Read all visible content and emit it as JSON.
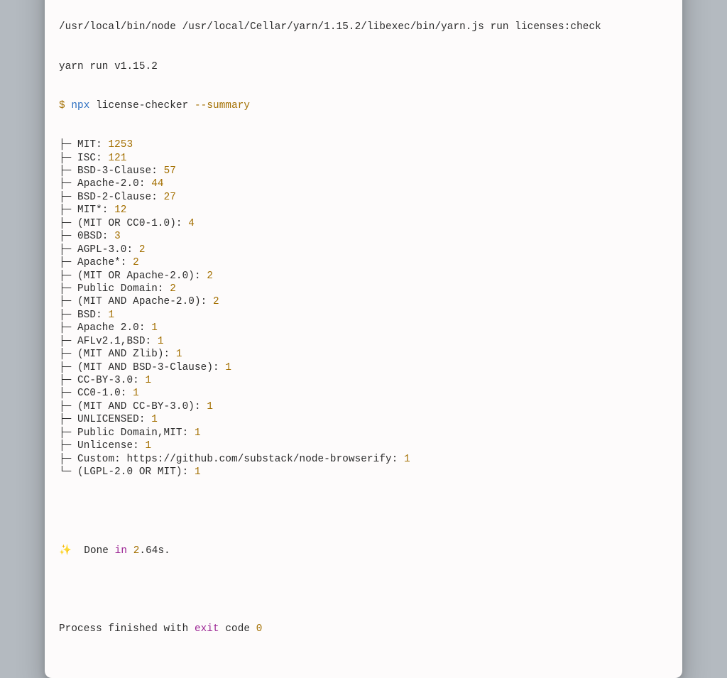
{
  "header": {
    "invocation": "/usr/local/bin/node /usr/local/Cellar/yarn/1.15.2/libexec/bin/yarn.js run licenses:check",
    "yarn_version_line": "yarn run v1.15.2"
  },
  "command": {
    "prompt": "$",
    "bin": "npx",
    "tool": "license-checker",
    "flag": "--summary"
  },
  "licenses": [
    {
      "prefix": "├─ ",
      "name": "MIT",
      "count": 1253
    },
    {
      "prefix": "├─ ",
      "name": "ISC",
      "count": 121
    },
    {
      "prefix": "├─ ",
      "name": "BSD-3-Clause",
      "count": 57
    },
    {
      "prefix": "├─ ",
      "name": "Apache-2.0",
      "count": 44
    },
    {
      "prefix": "├─ ",
      "name": "BSD-2-Clause",
      "count": 27
    },
    {
      "prefix": "├─ ",
      "name": "MIT*",
      "count": 12
    },
    {
      "prefix": "├─ ",
      "name": "(MIT OR CC0-1.0)",
      "count": 4
    },
    {
      "prefix": "├─ ",
      "name": "0BSD",
      "count": 3
    },
    {
      "prefix": "├─ ",
      "name": "AGPL-3.0",
      "count": 2
    },
    {
      "prefix": "├─ ",
      "name": "Apache*",
      "count": 2
    },
    {
      "prefix": "├─ ",
      "name": "(MIT OR Apache-2.0)",
      "count": 2
    },
    {
      "prefix": "├─ ",
      "name": "Public Domain",
      "count": 2
    },
    {
      "prefix": "├─ ",
      "name": "(MIT AND Apache-2.0)",
      "count": 2
    },
    {
      "prefix": "├─ ",
      "name": "BSD",
      "count": 1
    },
    {
      "prefix": "├─ ",
      "name": "Apache 2.0",
      "count": 1
    },
    {
      "prefix": "├─ ",
      "name": "AFLv2.1,BSD",
      "count": 1
    },
    {
      "prefix": "├─ ",
      "name": "(MIT AND Zlib)",
      "count": 1
    },
    {
      "prefix": "├─ ",
      "name": "(MIT AND BSD-3-Clause)",
      "count": 1
    },
    {
      "prefix": "├─ ",
      "name": "CC-BY-3.0",
      "count": 1
    },
    {
      "prefix": "├─ ",
      "name": "CC0-1.0",
      "count": 1
    },
    {
      "prefix": "├─ ",
      "name": "(MIT AND CC-BY-3.0)",
      "count": 1
    },
    {
      "prefix": "├─ ",
      "name": "UNLICENSED",
      "count": 1
    },
    {
      "prefix": "├─ ",
      "name": "Public Domain,MIT",
      "count": 1
    },
    {
      "prefix": "├─ ",
      "name": "Unlicense",
      "count": 1
    },
    {
      "prefix": "├─ ",
      "name": "Custom: https://github.com/substack/node-browserify",
      "count": 1
    },
    {
      "prefix": "└─ ",
      "name": "(LGPL-2.0 OR MIT)",
      "count": 1
    }
  ],
  "done": {
    "sparkle": "✨",
    "done_word": "Done",
    "in_word": "in",
    "time_int": "2",
    "time_frac": ".64s."
  },
  "exit": {
    "prefix": "Process finished with ",
    "exit_word": "exit",
    "mid": " code ",
    "code": "0"
  }
}
